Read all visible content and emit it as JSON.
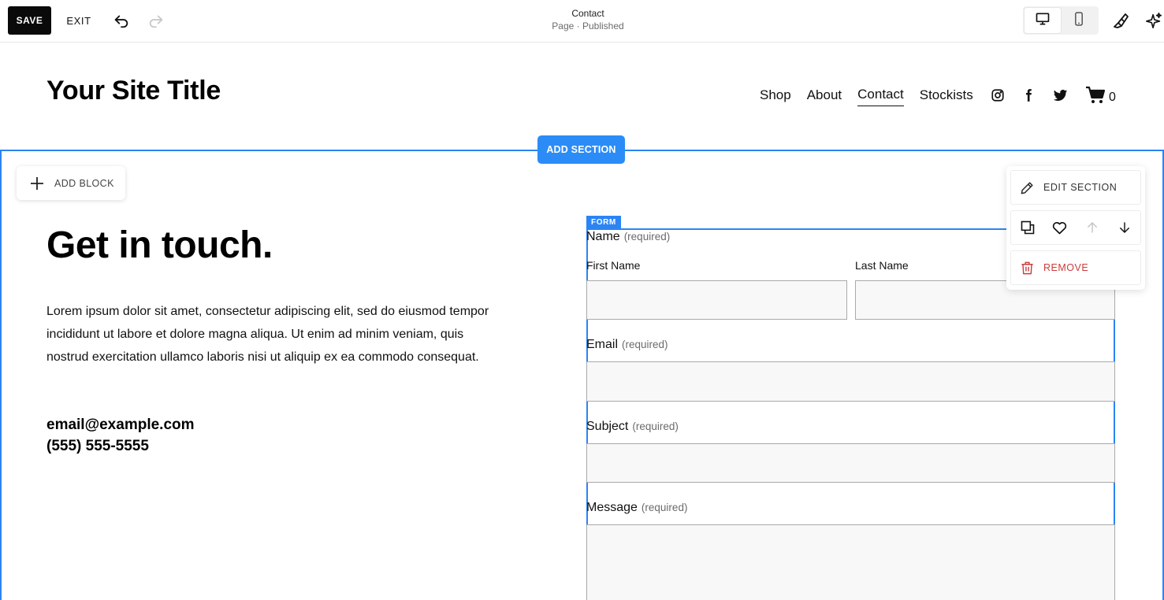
{
  "toolbar": {
    "save_label": "SAVE",
    "exit_label": "EXIT",
    "page_title": "Contact",
    "page_status": "Page · Published",
    "view_modes": [
      "desktop-icon",
      "mobile-icon"
    ],
    "active_view": "mobile"
  },
  "site": {
    "title": "Your Site Title",
    "nav": [
      {
        "label": "Shop",
        "active": false
      },
      {
        "label": "About",
        "active": false
      },
      {
        "label": "Contact",
        "active": true
      },
      {
        "label": "Stockists",
        "active": false
      }
    ],
    "social_icons": [
      "instagram-icon",
      "facebook-icon",
      "twitter-icon"
    ],
    "cart_count": "0"
  },
  "editor": {
    "add_section_label": "ADD SECTION",
    "add_block_label": "ADD BLOCK",
    "accent_color": "#2b84f4",
    "section_menu": {
      "edit_label": "EDIT SECTION",
      "actions": [
        "duplicate-icon",
        "favorite-icon",
        "move-up-icon",
        "move-down-icon"
      ],
      "remove_label": "REMOVE",
      "remove_color": "#cc3b3b"
    }
  },
  "content": {
    "heading": "Get in touch.",
    "body": "Lorem ipsum dolor sit amet, consectetur adipiscing elit, sed do eiusmod tempor incididunt ut labore et dolore magna aliqua. Ut enim ad minim veniam, quis nostrud exercitation ullamco laboris nisi ut aliquip ex ea commodo consequat.",
    "email": "email@example.com",
    "phone": "(555) 555-5555"
  },
  "form": {
    "tag": "FORM",
    "required_text": "(required)",
    "name_label": "Name",
    "first_name_label": "First Name",
    "last_name_label": "Last Name",
    "email_label": "Email",
    "subject_label": "Subject",
    "message_label": "Message"
  }
}
